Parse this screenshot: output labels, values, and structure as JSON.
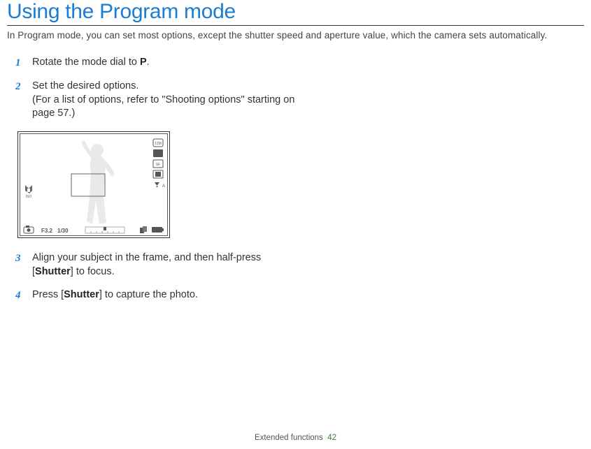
{
  "heading": "Using the Program mode",
  "intro": "In Program mode, you can set most options, except the shutter speed and aperture value, which the camera sets automatically.",
  "steps": {
    "s1": {
      "num": "1",
      "text_before": "Rotate the mode dial to ",
      "icon_name": "P",
      "text_after": "."
    },
    "s2": {
      "num": "2",
      "line1": "Set the desired options.",
      "line2": "(For a list of options, refer to \"Shooting options\" starting on page 57.)"
    },
    "s3": {
      "num": "3",
      "part_a": "Align your subject in the frame, and then half-press [",
      "shutter": "Shutter",
      "part_b": "] to focus."
    },
    "s4": {
      "num": "4",
      "part_a": "Press [",
      "shutter": "Shutter",
      "part_b": "] to capture the photo."
    }
  },
  "preview": {
    "aperture": "F3.2",
    "shutter": "1/30",
    "iso": "ISO"
  },
  "footer": {
    "section": "Extended functions",
    "page": "42"
  }
}
